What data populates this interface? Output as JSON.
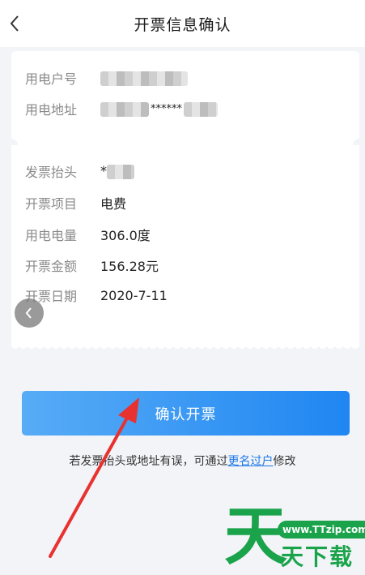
{
  "header": {
    "title": "开票信息确认",
    "back_icon": "chevron-left-icon"
  },
  "account": {
    "number_label": "用电户号",
    "address_label": "用电地址",
    "address_mask": "******"
  },
  "invoice": {
    "title_label": "发票抬头",
    "title_value_prefix": "*",
    "item_label": "开票项目",
    "item_value": "电费",
    "usage_label": "用电电量",
    "usage_value": "306.0度",
    "amount_label": "开票金额",
    "amount_value": "156.28元",
    "date_label": "开票日期",
    "date_value": "2020-7-11"
  },
  "confirm_button": {
    "label": "确认开票"
  },
  "note": {
    "prefix": "若发票抬头或地址有误，可通过",
    "link": "更名过户",
    "suffix": "修改"
  },
  "watermark": {
    "big": "天",
    "badge": "www.TTzip.com",
    "small": "天下载"
  },
  "colors": {
    "accent": "#1f86f2",
    "link": "#1e78e6",
    "annotation_arrow": "#e8322f",
    "watermark": "#1aa34a"
  }
}
